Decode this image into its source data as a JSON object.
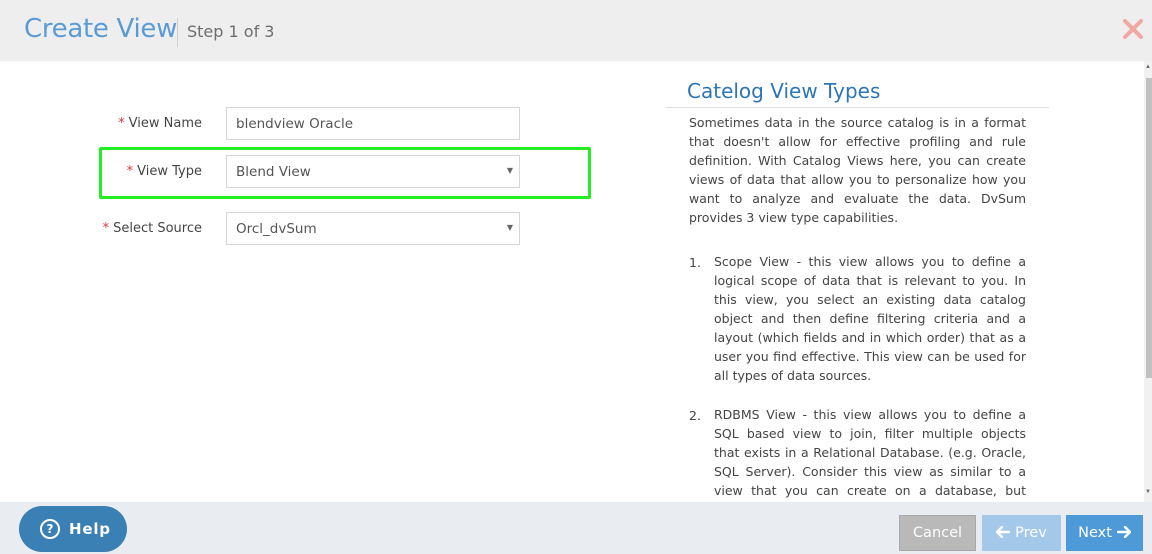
{
  "header": {
    "title": "Create View",
    "step": "Step 1 of 3",
    "close_icon": "close-icon"
  },
  "form": {
    "required_marker": "*",
    "view_name": {
      "label": "View Name",
      "value": "blendview Oracle"
    },
    "view_type": {
      "label": "View Type",
      "value": "Blend View"
    },
    "select_source": {
      "label": "Select Source",
      "value": "Orcl_dvSum"
    }
  },
  "panel": {
    "title": "Catelog View Types",
    "intro": "Sometimes data in the source catalog is in a format that doesn't allow for effective profiling and rule definition. With Catalog Views here, you can create views of data that allow you to personalize how you want to analyze and evaluate the data. DvSum provides 3 view type capabilities.",
    "items": [
      {
        "number": "1.",
        "text": "Scope View - this view allows you to define a logical scope of data that is relevant to you. In this view, you select an existing data catalog object and then define filtering criteria and a layout (which fields and in which order) that as a user you find effective. This view can be used for all types of data sources."
      },
      {
        "number": "2.",
        "text": "RDBMS View - this view allows you to define a SQL based view to join, filter multiple objects that exists in a Relational Database. (e.g. Oracle, SQL Server). Consider this view as similar to a view that you can create on a database, but don't have to. You can"
      }
    ]
  },
  "footer": {
    "help_label": "Help",
    "help_icon_glyph": "?",
    "cancel_label": "Cancel",
    "prev_label": "Prev",
    "next_label": "Next"
  },
  "colors": {
    "title": "#5b9bd5",
    "highlight": "#22ee22",
    "required": "#d9363e",
    "next_button": "#4e9ad8",
    "prev_button": "#a3c8ea",
    "cancel_button": "#b9b9b9",
    "help_button": "#3a80b5"
  }
}
